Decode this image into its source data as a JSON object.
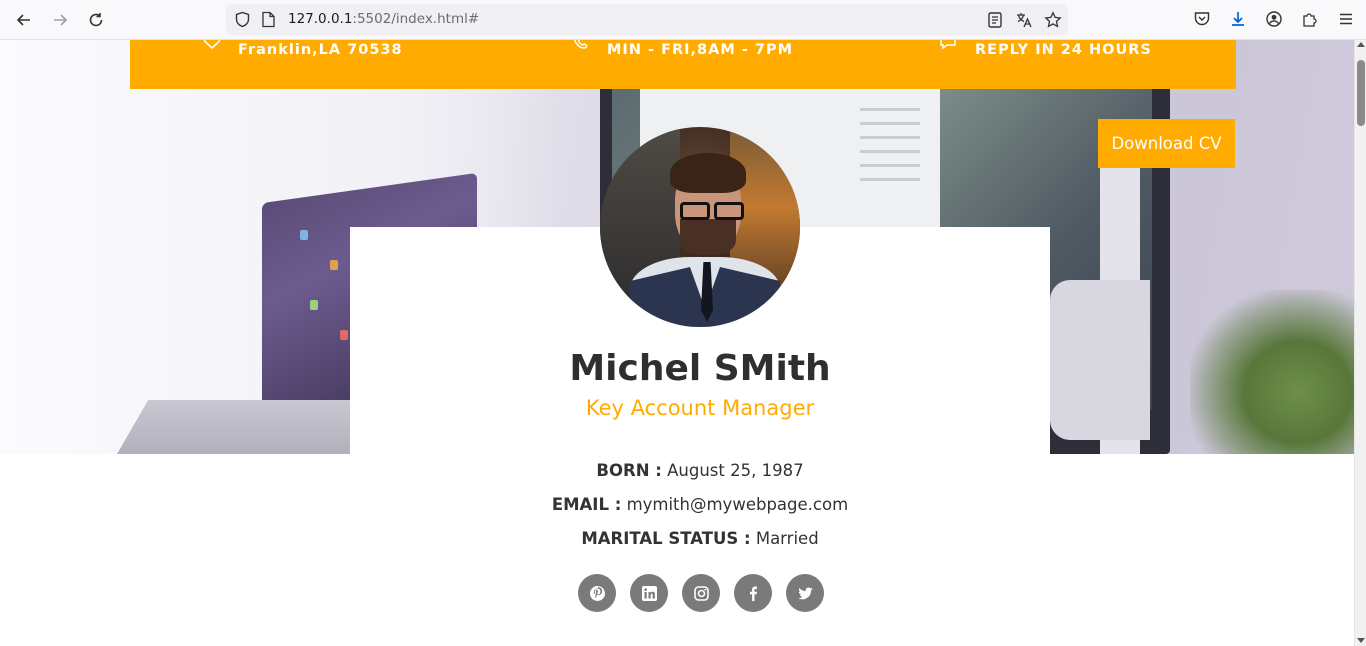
{
  "browser": {
    "url_host": "127.0.0.1",
    "url_rest": ":5502/index.html#"
  },
  "banner": {
    "items": [
      {
        "icon": "heart-icon",
        "text": "Franklin,LA 70538"
      },
      {
        "icon": "phone-icon",
        "text": "MIN - FRI,8AM - 7PM"
      },
      {
        "icon": "chat-icon",
        "text": "REPLY IN 24 HOURS"
      }
    ]
  },
  "download_button": "Download CV",
  "profile": {
    "name": "Michel SMith",
    "role": "Key Account Manager",
    "born_label": "BORN :",
    "born_value": "August 25, 1987",
    "email_label": "EMAIL :",
    "email_value": "mymith@mywebpage.com",
    "marital_label": "MARITAL STATUS :",
    "marital_value": "Married"
  },
  "socials": [
    {
      "icon": "pinterest-icon"
    },
    {
      "icon": "linkedin-icon"
    },
    {
      "icon": "instagram-icon"
    },
    {
      "icon": "facebook-icon"
    },
    {
      "icon": "twitter-icon"
    }
  ],
  "colors": {
    "accent": "#ffab00",
    "social_bg": "#7a7a7a",
    "text": "#333333"
  }
}
